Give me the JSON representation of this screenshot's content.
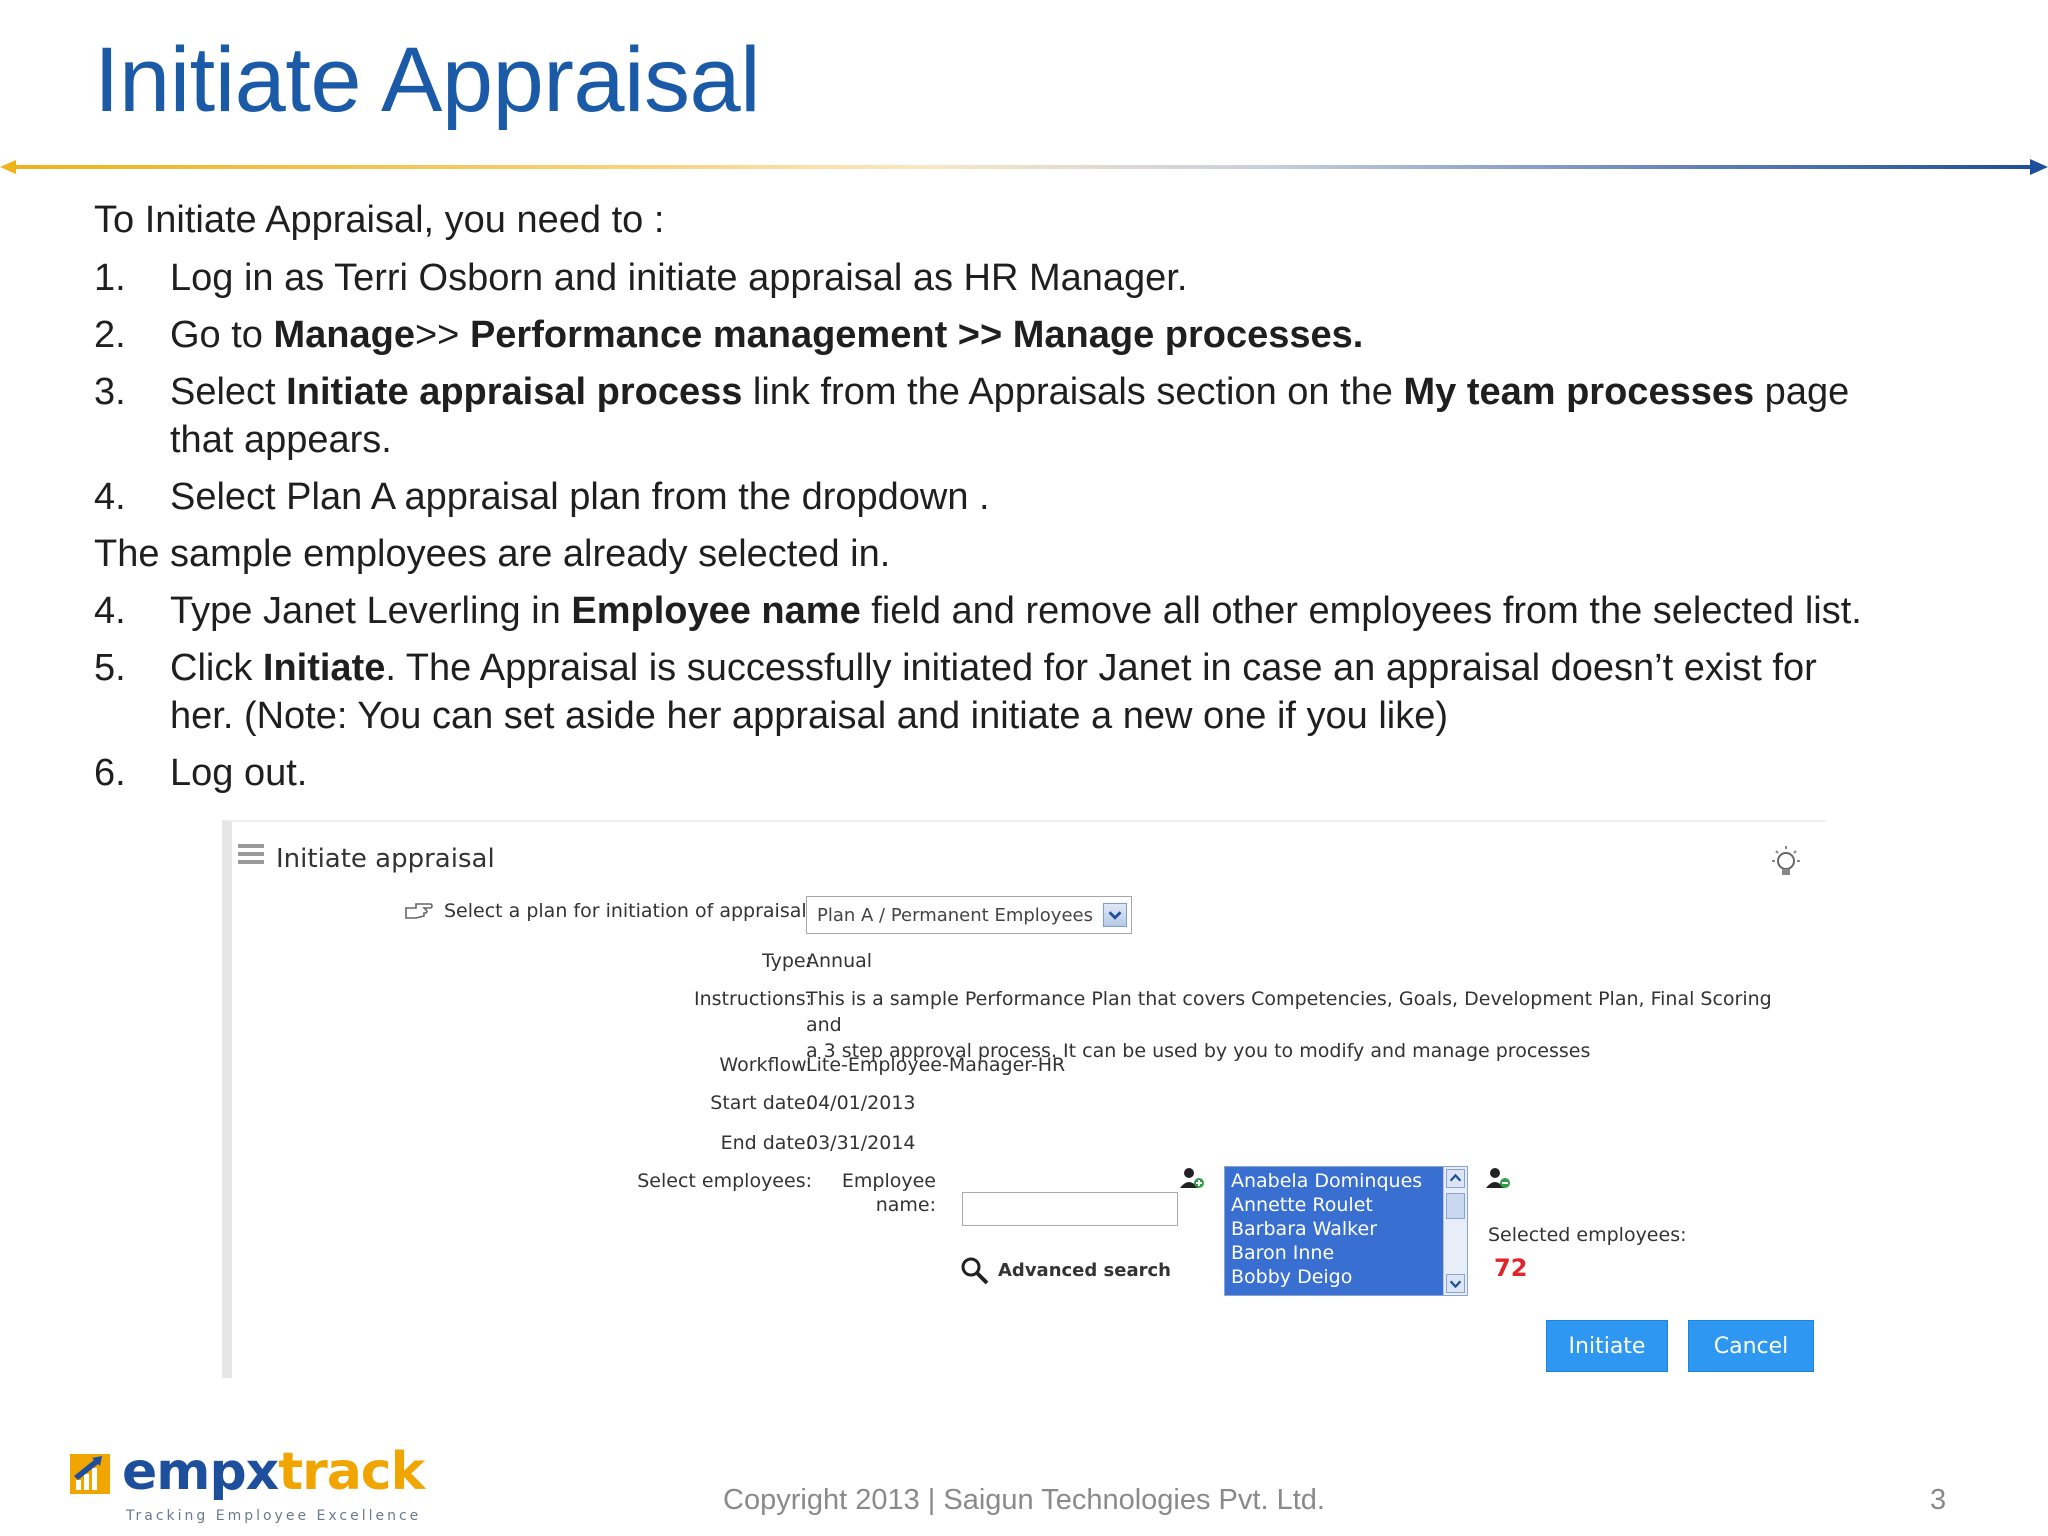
{
  "slide": {
    "title": "Initiate Appraisal",
    "intro": "To Initiate Appraisal, you need to :",
    "steps": [
      {
        "num": "1.",
        "html_parts": [
          "Log in as Terri Osborn and initiate appraisal as HR Manager."
        ]
      },
      {
        "num": "2.",
        "a": "Go to ",
        "b": "Manage",
        "c": ">> ",
        "d": "Performance management >> Manage processes."
      },
      {
        "num": "3.",
        "a": "Select ",
        "b": "Initiate appraisal process",
        "c": " link from the Appraisals section on the ",
        "d": "My team processes",
        "e": " page",
        "f": "that appears."
      },
      {
        "num": "4.",
        "a": "Select Plan A appraisal plan from the dropdown ."
      },
      {
        "num": "4.",
        "a": "Type Janet Leverling in ",
        "b": "Employee name",
        "c": " field and remove all other employees from the selected list."
      },
      {
        "num": "5.",
        "a": "Click ",
        "b": "Initiate",
        "c": ". The Appraisal is successfully initiated for Janet in case an appraisal doesn’t exist for",
        "d": "her. (Note: You can set aside her appraisal and initiate a new one if you like)"
      },
      {
        "num": "6.",
        "a": "Log out."
      }
    ],
    "note": "The sample employees are already selected in."
  },
  "panel": {
    "title": "Initiate appraisal",
    "select_plan_label": "Select a plan for initiation of appraisal:",
    "plan_value": "Plan A / Permanent Employees",
    "type_label": "Type:",
    "type_value": "Annual",
    "instructions_label": "Instructions:",
    "instructions_line1": "This is a sample Performance Plan that covers Competencies, Goals, Development Plan, Final Scoring and",
    "instructions_line2": "a 3 step approval process. It can be used by you to modify and manage processes",
    "workflow_label": "Workflow:",
    "workflow_value": "Lite-Employee-Manager-HR",
    "start_label": "Start date:",
    "start_value": "04/01/2013",
    "end_label": "End date:",
    "end_value": "03/31/2014",
    "select_employees_label": "Select employees:",
    "employee_name_label_1": "Employee",
    "employee_name_label_2": "name:",
    "employee_name_value": "",
    "advanced_search": "Advanced search",
    "employees": [
      "Anabela Dominques",
      "Annette Roulet",
      "Barbara Walker",
      "Baron Inne",
      "Bobby Deigo"
    ],
    "selected_label": "Selected employees:",
    "selected_count": "72",
    "initiate_button": "Initiate",
    "cancel_button": "Cancel"
  },
  "footer": {
    "logo_part1": "empx",
    "logo_part2": "track",
    "logo_tagline": "Tracking Employee Excellence",
    "copyright": "Copyright 2013 | Saigun Technologies Pvt. Ltd.",
    "page": "3"
  },
  "colors": {
    "title_blue": "#1b5aa6",
    "button_blue": "#2d97f2",
    "list_blue": "#3a6fd2",
    "count_red": "#e0242a"
  }
}
